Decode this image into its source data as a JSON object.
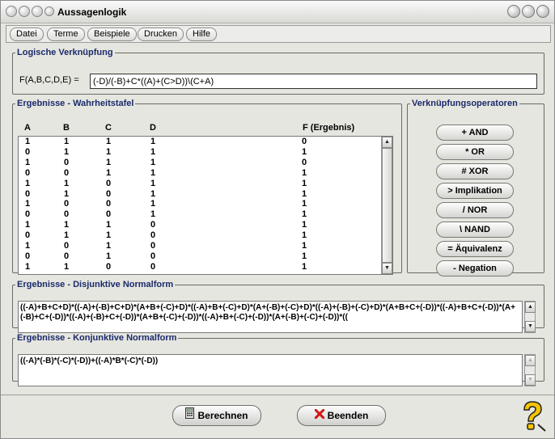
{
  "window": {
    "title": "Aussagenlogik"
  },
  "menu": [
    "Datei",
    "Terme",
    "Beispiele",
    "Drucken",
    "Hilfe"
  ],
  "logic": {
    "legend": "Logische Verknüpfung",
    "label": "F(A,B,C,D,E) =",
    "formula": "(-D)/(-B)+C*((A)+(C>D))\\(C+A)"
  },
  "truth_table": {
    "legend": "Ergebnisse - Wahrheitstafel",
    "headers": [
      "A",
      "B",
      "C",
      "D",
      "F (Ergebnis)"
    ],
    "rows": [
      [
        "1",
        "1",
        "1",
        "1",
        "0"
      ],
      [
        "0",
        "1",
        "1",
        "1",
        "1"
      ],
      [
        "1",
        "0",
        "1",
        "1",
        "0"
      ],
      [
        "0",
        "0",
        "1",
        "1",
        "1"
      ],
      [
        "1",
        "1",
        "0",
        "1",
        "1"
      ],
      [
        "0",
        "1",
        "0",
        "1",
        "1"
      ],
      [
        "1",
        "0",
        "0",
        "1",
        "1"
      ],
      [
        "0",
        "0",
        "0",
        "1",
        "1"
      ],
      [
        "1",
        "1",
        "1",
        "0",
        "1"
      ],
      [
        "0",
        "1",
        "1",
        "0",
        "1"
      ],
      [
        "1",
        "0",
        "1",
        "0",
        "1"
      ],
      [
        "0",
        "0",
        "1",
        "0",
        "1"
      ],
      [
        "1",
        "1",
        "0",
        "0",
        "1"
      ]
    ]
  },
  "operators": {
    "legend": "Verknüpfungsoperatoren",
    "buttons": [
      "+  AND",
      "*   OR",
      "#  XOR",
      ">  Implikation",
      "/   NOR",
      "\\   NAND",
      "=  Äquivalenz",
      "-   Negation"
    ]
  },
  "dnf": {
    "legend": "Ergebnisse - Disjunktive Normalform",
    "text": "((-A)+B+C+D)*((-A)+(-B)+C+D)*(A+B+(-C)+D)*((-A)+B+(-C)+D)*(A+(-B)+(-C)+D)*((-A)+(-B)+(-C)+D)*(A+B+C+(-D))*((-A)+B+C+(-D))*(A+(-B)+C+(-D))*((-A)+(-B)+C+(-D))*(A+B+(-C)+(-D))*((-A)+B+(-C)+(-D))*(A+(-B)+(-C)+(-D))*(("
  },
  "cnf": {
    "legend": "Ergebnisse - Konjunktive Normalform",
    "text": "((-A)*(-B)*(-C)*(-D))+((-A)*B*(-C)*(-D))"
  },
  "actions": {
    "compute": "Berechnen",
    "exit": "Beenden"
  },
  "icons": {
    "compute": "calculator-icon",
    "exit": "red-x-icon",
    "help": "question-mark-icon"
  },
  "colors": {
    "legend": "#1a2a6a",
    "exit_x": "#d01818",
    "help": "#f4c400"
  }
}
